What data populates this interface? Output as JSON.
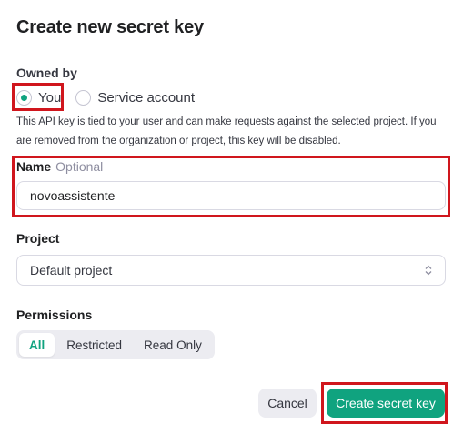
{
  "dialog": {
    "title": "Create new secret key"
  },
  "owned_by": {
    "label": "Owned by",
    "options": [
      {
        "label": "You",
        "selected": true
      },
      {
        "label": "Service account",
        "selected": false
      }
    ],
    "help_text": "This API key is tied to your user and can make requests against the selected project. If you are removed from the organization or project, this key will be disabled."
  },
  "name": {
    "label": "Name",
    "optional_label": "Optional",
    "value": "novoassistente"
  },
  "project": {
    "label": "Project",
    "selected": "Default project"
  },
  "permissions": {
    "label": "Permissions",
    "options": [
      "All",
      "Restricted",
      "Read Only"
    ],
    "selected": "All"
  },
  "buttons": {
    "cancel": "Cancel",
    "create": "Create secret key"
  },
  "colors": {
    "accent": "#10a37f",
    "highlight": "#d0161d"
  },
  "icons": {
    "project_select": "chevron-updown-icon"
  }
}
